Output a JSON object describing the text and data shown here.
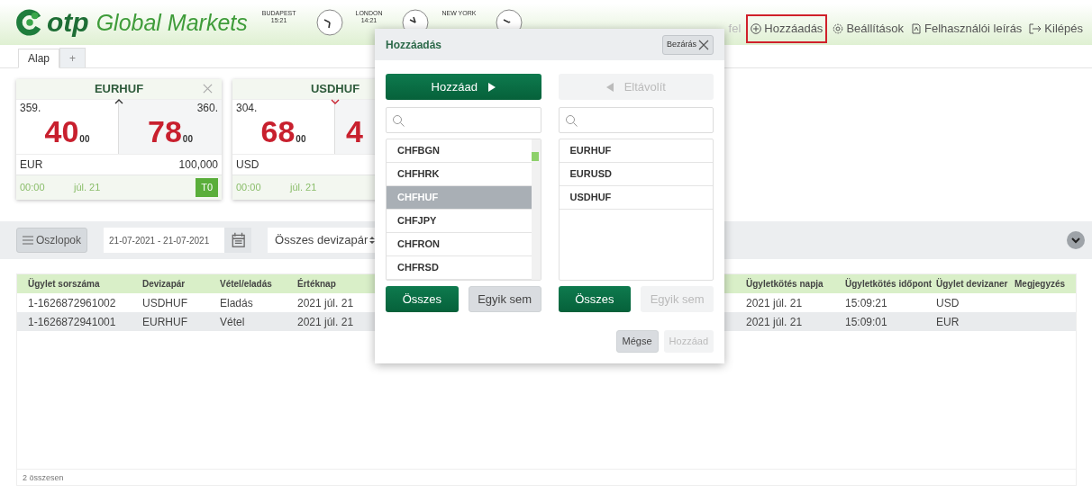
{
  "header": {
    "logo": {
      "brand": "otp",
      "product": "Global Markets"
    },
    "clocks": [
      {
        "city": "BUDAPEST",
        "time": "15:21"
      },
      {
        "city": "LONDON",
        "time": "14:21"
      },
      {
        "city": "NEW YORK"
      }
    ],
    "nav": [
      {
        "label": "fel",
        "kind": "user",
        "highlighted": false
      },
      {
        "label": "Hozzáadás",
        "kind": "add",
        "highlighted": true
      },
      {
        "label": "Beállítások",
        "kind": "settings",
        "highlighted": false
      },
      {
        "label": "Felhasználói leírás",
        "kind": "document",
        "highlighted": false
      },
      {
        "label": "Kilépés",
        "kind": "logout",
        "highlighted": false
      }
    ]
  },
  "tabs": [
    {
      "label": "Alap",
      "selected": true
    },
    {
      "label": "+",
      "selected": false
    }
  ],
  "cards": [
    {
      "pair": "EURHUF",
      "closable": true,
      "rising": true,
      "bid_prefix": "359.",
      "bid": "40",
      "bid_suffix": "00",
      "ask_prefix": "360.",
      "ask": "78",
      "ask_suffix": "00",
      "currency": "EUR",
      "amount": "100,000",
      "time": "00:00",
      "date": "júl. 21",
      "tenor": "T0"
    },
    {
      "pair": "USDHUF",
      "rising": false,
      "bid_prefix": "304.",
      "bid": "68",
      "bid_suffix": "00",
      "ask": "4",
      "currency": "USD",
      "time": "00:00",
      "date": "júl. 21"
    }
  ],
  "toolbar": {
    "columns_button": "Oszlopok",
    "date_range": "21-07-2021 - 21-07-2021",
    "pair_select": "Összes devizapár"
  },
  "table": {
    "columns_left": [
      "Ügylet sorszáma",
      "Devizapár",
      "Vétel/eladás",
      "Értéknap"
    ],
    "columns_right": [
      "Ügyletkötés napja",
      "Ügyletkötés időpont",
      "Ügylet devizaner",
      "Megjegyzés"
    ],
    "rows": [
      {
        "left": [
          "1-1626872961002",
          "USDHUF",
          "Eladás",
          "2021 júl. 21"
        ],
        "right": [
          "2021 júl. 21",
          "15:09:21",
          "USD"
        ]
      },
      {
        "left": [
          "1-1626872941001",
          "EURHUF",
          "Vétel",
          "2021 júl. 21"
        ],
        "right": [
          "2021 júl. 21",
          "15:09:01",
          "EUR"
        ]
      }
    ],
    "footer": "2 összesen"
  },
  "modal": {
    "title": "Hozzáadás",
    "close_label": "Bezárás",
    "add_button": {
      "label": "Hozzáad",
      "disabled": false
    },
    "remove_button": {
      "label": "Eltávolít",
      "disabled": true
    },
    "left_list": [
      {
        "label": "CHFBGN",
        "selected": false
      },
      {
        "label": "CHFHRK",
        "selected": false
      },
      {
        "label": "CHFHUF",
        "selected": true
      },
      {
        "label": "CHFJPY",
        "selected": false
      },
      {
        "label": "CHFRON",
        "selected": false
      },
      {
        "label": "CHFRSD",
        "selected": false
      }
    ],
    "right_list": [
      {
        "label": "EURHUF",
        "selected": false
      },
      {
        "label": "EURUSD",
        "selected": false
      },
      {
        "label": "USDHUF",
        "selected": false
      }
    ],
    "left_buttons": [
      {
        "label": "Összes",
        "kind": "primary"
      },
      {
        "label": "Egyik sem",
        "kind": "secondary"
      }
    ],
    "right_buttons": [
      {
        "label": "Összes",
        "kind": "primary"
      },
      {
        "label": "Egyik sem",
        "kind": "disabled"
      }
    ],
    "footer_buttons": [
      {
        "label": "Mégse",
        "kind": "secondary"
      },
      {
        "label": "Hozzáad",
        "kind": "disabled"
      }
    ]
  }
}
